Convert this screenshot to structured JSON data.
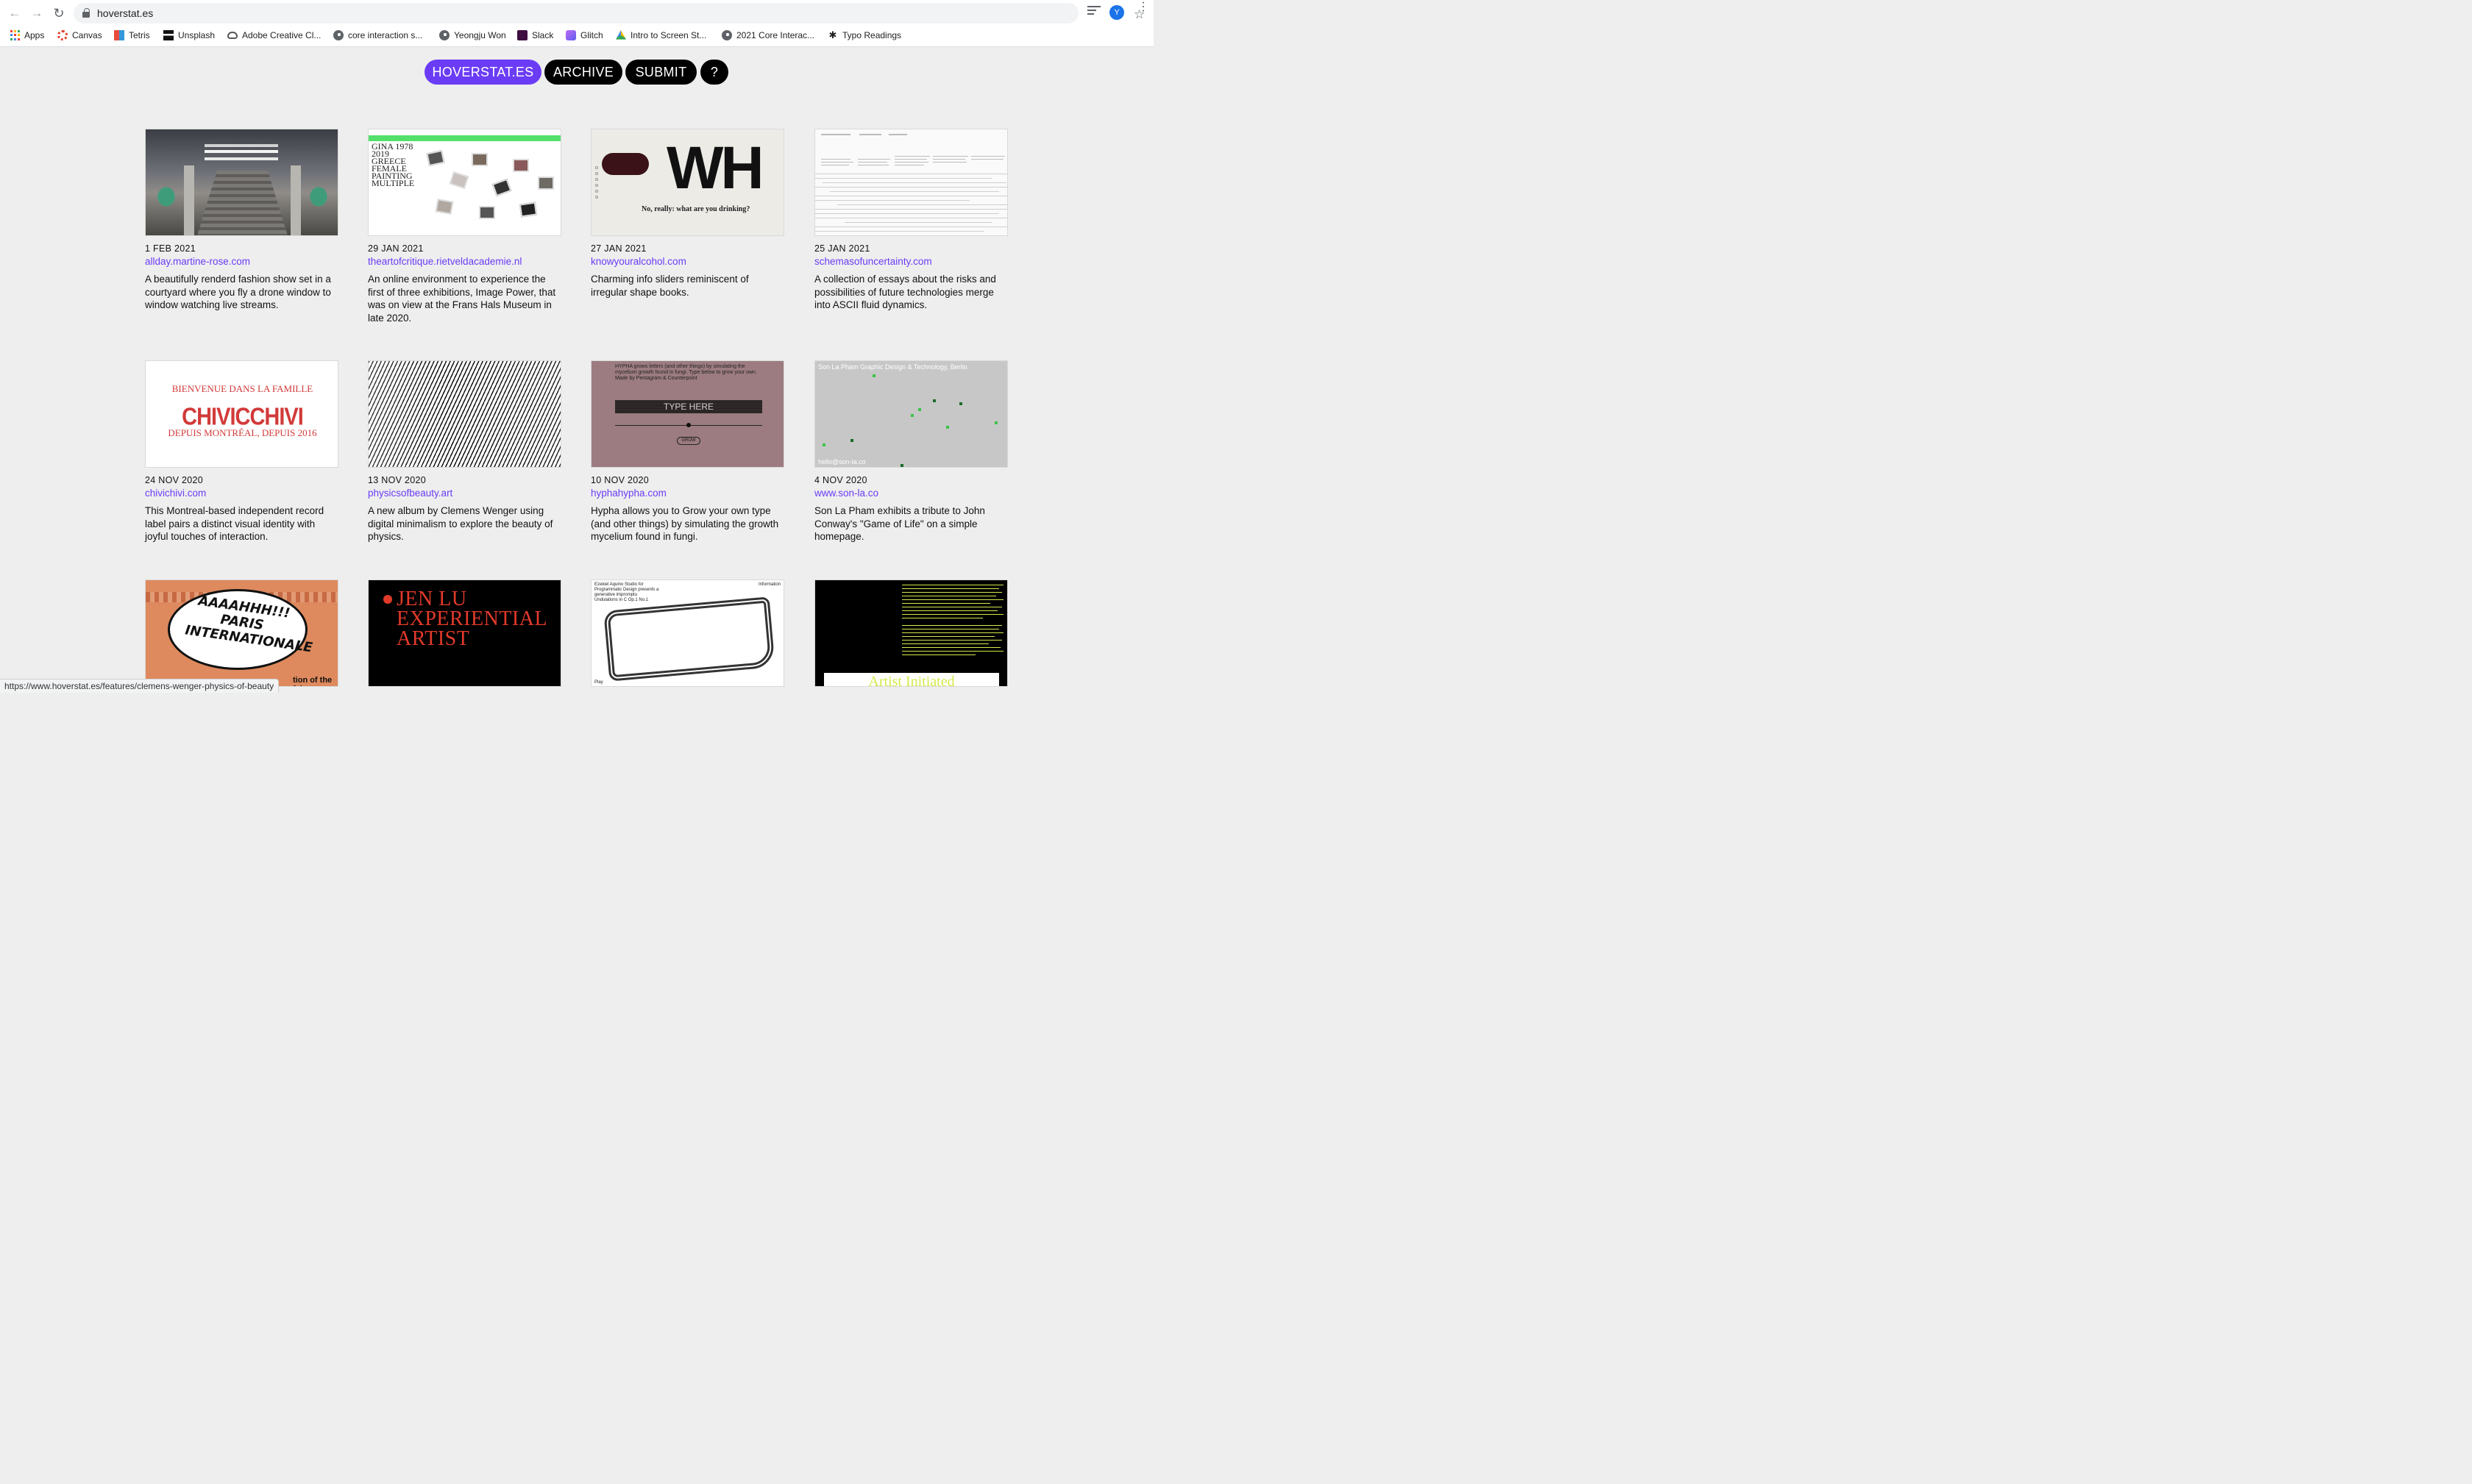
{
  "browser": {
    "url": "hoverstat.es",
    "avatar_letter": "Y",
    "bookmarks": [
      {
        "label": "Apps",
        "icon": "apps-grid-icon"
      },
      {
        "label": "Canvas",
        "icon": "canvas-icon"
      },
      {
        "label": "Tetris",
        "icon": "tetris-icon"
      },
      {
        "label": "Unsplash",
        "icon": "unsplash-icon"
      },
      {
        "label": "Adobe Creative Cl...",
        "icon": "adobe-cloud-icon"
      },
      {
        "label": "core interaction s...",
        "icon": "globe-icon"
      },
      {
        "label": "Yeongju Won",
        "icon": "globe-icon"
      },
      {
        "label": "Slack",
        "icon": "slack-icon"
      },
      {
        "label": "Glitch",
        "icon": "glitch-icon"
      },
      {
        "label": "Intro to Screen St...",
        "icon": "drive-icon"
      },
      {
        "label": "2021 Core Interac...",
        "icon": "globe-icon"
      },
      {
        "label": "Typo Readings",
        "icon": "typo-icon"
      }
    ],
    "status_url": "https://www.hoverstat.es/features/clemens-wenger-physics-of-beauty"
  },
  "site_nav": {
    "home": "HOVERSTAT.ES",
    "archive": "ARCHIVE",
    "submit": "SUBMIT",
    "help": "?"
  },
  "cards": [
    {
      "date": "1 FEB 2021",
      "link": "allday.martine-rose.com",
      "desc": "A beautifully renderd fashion show set in a courtyard where you fly a drone window to window watching live streams."
    },
    {
      "date": "29 JAN 2021",
      "link": "theartofcritique.rietveldacademie.nl",
      "desc": "An online environment to experience the first of three exhibitions, Image Power, that was on view at the Frans Hals Museum in late 2020."
    },
    {
      "date": "27 JAN 2021",
      "link": "knowyouralcohol.com",
      "desc": "Charming info sliders reminiscent of irregular shape books."
    },
    {
      "date": "25 JAN 2021",
      "link": "schemasofuncertainty.com",
      "desc": "A collection of essays about the risks and possibilities of future technologies merge into ASCII fluid dynamics."
    },
    {
      "date": "24 NOV 2020",
      "link": "chivichivi.com",
      "desc": "This Montreal-based independent record label pairs a distinct visual identity with joyful touches of interaction."
    },
    {
      "date": "13 NOV 2020",
      "link": "physicsofbeauty.art",
      "desc": "A new album by Clemens Wenger using digital minimalism to explore the beauty of physics."
    },
    {
      "date": "10 NOV 2020",
      "link": "hyphahypha.com",
      "desc": "Hypha allows you to Grow your own type (and other things) by simulating the growth mycelium found in fungi."
    },
    {
      "date": "4 NOV 2020",
      "link": "www.son-la.co",
      "desc": "Son La Pham exhibits a tribute to John Conway's \"Game of Life\" on a simple homepage."
    }
  ],
  "thumbs": {
    "critique_list": "GINA 1978 2019 GREECE FEMALE PAINTING MULTIPLE",
    "alcohol_big": "WH",
    "alcohol_question": "No, really: what are you drinking?",
    "chivi_top": "BIENVENUE DANS LA FAMILLE",
    "chivi_big": "CHIVICCHIVI",
    "chivi_bottom": "DEPUIS MONTRÉAL, DEPUIS 2016",
    "hypha_top": "HYPHA grows letters (and other things) by simulating the mycelium growth found in fungi. Type below to grow your own. Made by Pentagram & Counterpoint",
    "hypha_input": "TYPE HERE",
    "hypha_grow": "GROW",
    "sonla_header": "Son La Pham Graphic Design & Technology, Berlin",
    "sonla_footer": "hello@son-la.co",
    "paris_bubble": "AAAAHHH!!! PARIS INTERNATIONALE",
    "paris_bottom": "tion of the fair",
    "jenlu_title": "JEN LU EXPERIENTIAL ARTIST",
    "ezekiel_header": "Ezekiel Aquino Studio for Programmatic Design presents a generative impromptu Undulations in C Op.1 No.1",
    "ezekiel_info": "Information",
    "ezekiel_play": "Play",
    "artist_band": "Artist Initiated"
  },
  "colors": {
    "accent": "#6b3cf5",
    "pill_bg": "#000000",
    "page_bg": "#eeeeee"
  }
}
